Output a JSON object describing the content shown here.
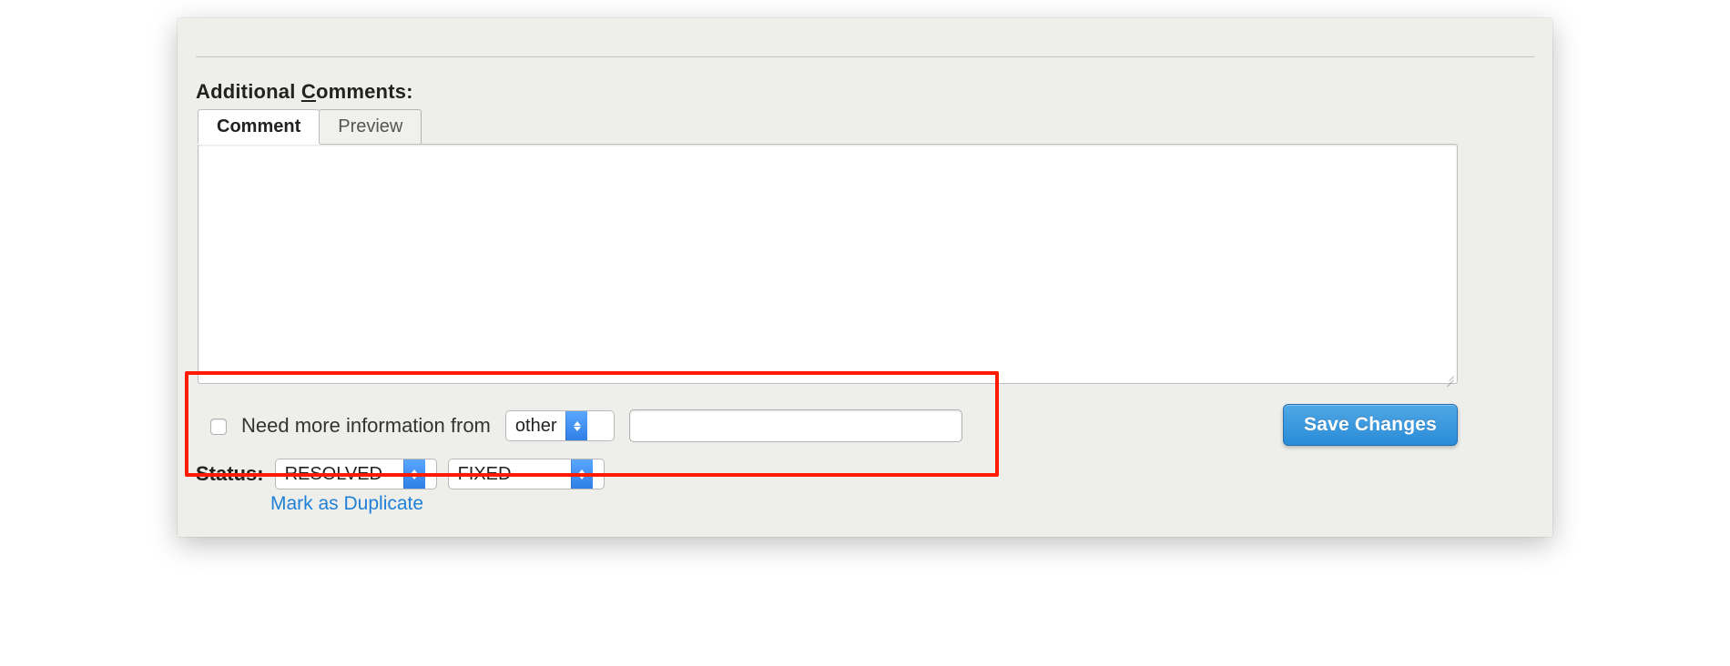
{
  "section": {
    "title_pre": "Additional ",
    "title_ul": "C",
    "title_post": "omments:"
  },
  "tabs": {
    "comment": "Comment",
    "preview": "Preview",
    "active": "comment"
  },
  "textarea": {
    "value": ""
  },
  "needinfo": {
    "checked": false,
    "label": "Need more information from",
    "from_select": "other",
    "from_input": ""
  },
  "status": {
    "label": "Status:",
    "value": "RESOLVED",
    "resolution": "FIXED",
    "duplicate_link": "Mark as Duplicate"
  },
  "actions": {
    "save": "Save Changes"
  }
}
